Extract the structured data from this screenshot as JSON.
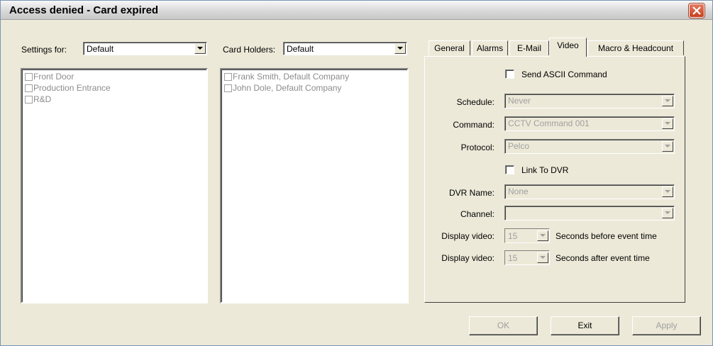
{
  "window": {
    "title": "Access denied - Card expired"
  },
  "settings": {
    "label": "Settings for:",
    "value": "Default",
    "doors": [
      "Front Door",
      "Production Entrance",
      "R&D"
    ]
  },
  "cardholders": {
    "label": "Card Holders:",
    "value": "Default",
    "items": [
      "Frank Smith, Default Company",
      "John Dole, Default Company"
    ]
  },
  "tabs": [
    "General",
    "Alarms",
    "E-Mail",
    "Video",
    "Macro & Headcount"
  ],
  "active_tab": "Video",
  "video": {
    "send_ascii_label": "Send ASCII Command",
    "schedule_label": "Schedule:",
    "schedule_value": "Never",
    "command_label": "Command:",
    "command_value": "CCTV Command 001",
    "protocol_label": "Protocol:",
    "protocol_value": "Pelco",
    "link_dvr_label": "Link To DVR",
    "dvr_name_label": "DVR Name:",
    "dvr_name_value": "None",
    "channel_label": "Channel:",
    "channel_value": "",
    "display_video_label": "Display video:",
    "before_value": "15",
    "before_suffix": "Seconds before event time",
    "after_value": "15",
    "after_suffix": "Seconds after event time"
  },
  "buttons": {
    "ok": "OK",
    "exit": "Exit",
    "apply": "Apply"
  }
}
